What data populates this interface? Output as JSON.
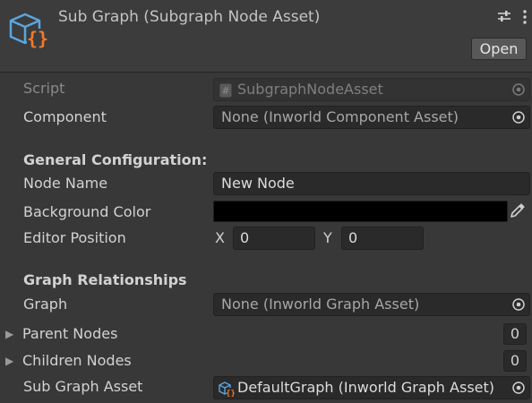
{
  "header": {
    "title": "Sub Graph (Subgraph Node Asset)",
    "open_label": "Open",
    "asset_icon": "cube-braces-icon",
    "settings_icon": "sliders-icon",
    "menu_icon": "vertical-ellipsis-icon"
  },
  "fields": {
    "script_label": "Script",
    "script_value": "SubgraphNodeAsset",
    "component_label": "Component",
    "component_value": "None (Inworld Component Asset)"
  },
  "general": {
    "heading": "General Configuration:",
    "node_name_label": "Node Name",
    "node_name_value": "New Node",
    "bg_color_label": "Background Color",
    "bg_color_value": "#000000",
    "editor_position_label": "Editor Position",
    "x_label": "X",
    "x_value": "0",
    "y_label": "Y",
    "y_value": "0"
  },
  "relationships": {
    "heading": "Graph Relationships",
    "graph_label": "Graph",
    "graph_value": "None (Inworld Graph Asset)",
    "parent_nodes_label": "Parent Nodes",
    "parent_nodes_count": "0",
    "children_nodes_label": "Children Nodes",
    "children_nodes_count": "0",
    "sub_graph_label": "Sub Graph Asset",
    "sub_graph_value": "DefaultGraph (Inworld Graph Asset)"
  },
  "colors": {
    "accent_blue": "#5aa6e0",
    "accent_orange": "#f07a2a"
  }
}
